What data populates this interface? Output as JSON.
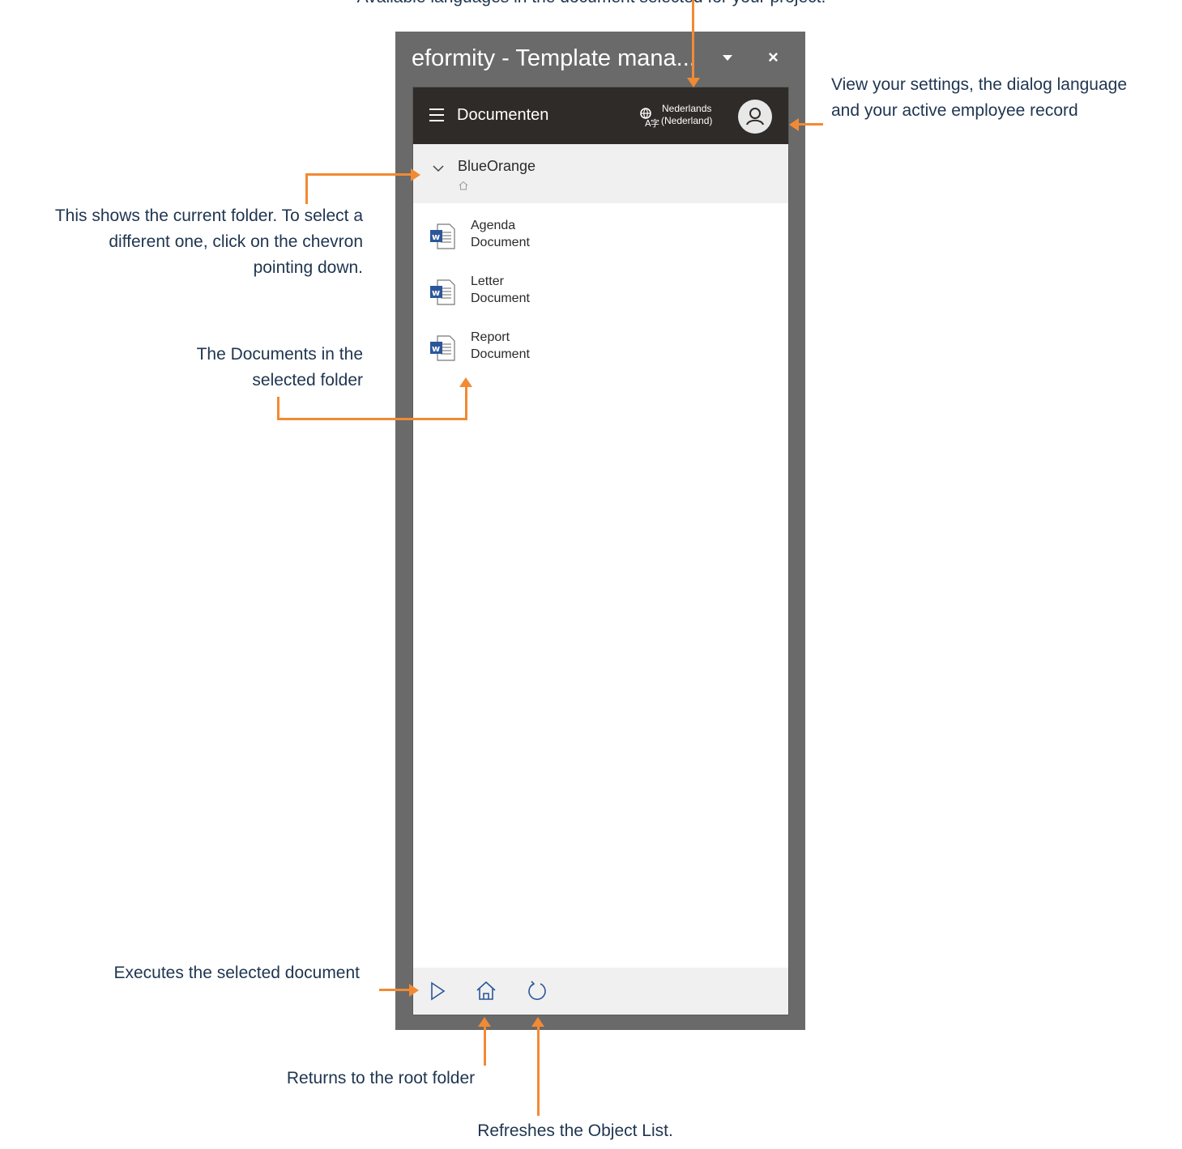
{
  "pane": {
    "title": "eformity - Template mana...",
    "dropdown_icon": "caret-down-icon",
    "close_label": "×"
  },
  "appbar": {
    "menu_icon": "hamburger-menu-icon",
    "title": "Documenten",
    "language_icon": "translate-icon",
    "language_line1": "Nederlands",
    "language_line2": "(Nederland)",
    "avatar_icon": "user-icon"
  },
  "folder": {
    "name": "BlueOrange",
    "chevron_icon": "chevron-down-icon",
    "home_icon": "home-icon"
  },
  "documents": [
    {
      "name": "Agenda",
      "type": "Document",
      "icon": "word-document-icon"
    },
    {
      "name": "Letter",
      "type": "Document",
      "icon": "word-document-icon"
    },
    {
      "name": "Report",
      "type": "Document",
      "icon": "word-document-icon"
    }
  ],
  "footer": {
    "play_icon": "play-icon",
    "home_icon": "home-icon",
    "refresh_icon": "refresh-icon"
  },
  "annotations": {
    "language_note": "Available languages in the document selected for your project.",
    "settings_note_line1": "View your settings, the dialog language",
    "settings_note_line2": "and your active employee record",
    "folder_note_line1": "This shows the current folder. To select a",
    "folder_note_line2": "different one, click on the chevron",
    "folder_note_line3": "pointing down.",
    "documents_note_line1": "The Documents in the",
    "documents_note_line2": "selected folder",
    "execute_note": "Executes the selected document",
    "root_note": "Returns to the root folder",
    "refresh_note": "Refreshes the Object List."
  },
  "colors": {
    "accent_orange": "#f28a33",
    "annotation_text": "#1f3550",
    "appbar": "#2f2b28",
    "pane_frame": "#6a6a6a",
    "word_blue": "#2b579a"
  }
}
